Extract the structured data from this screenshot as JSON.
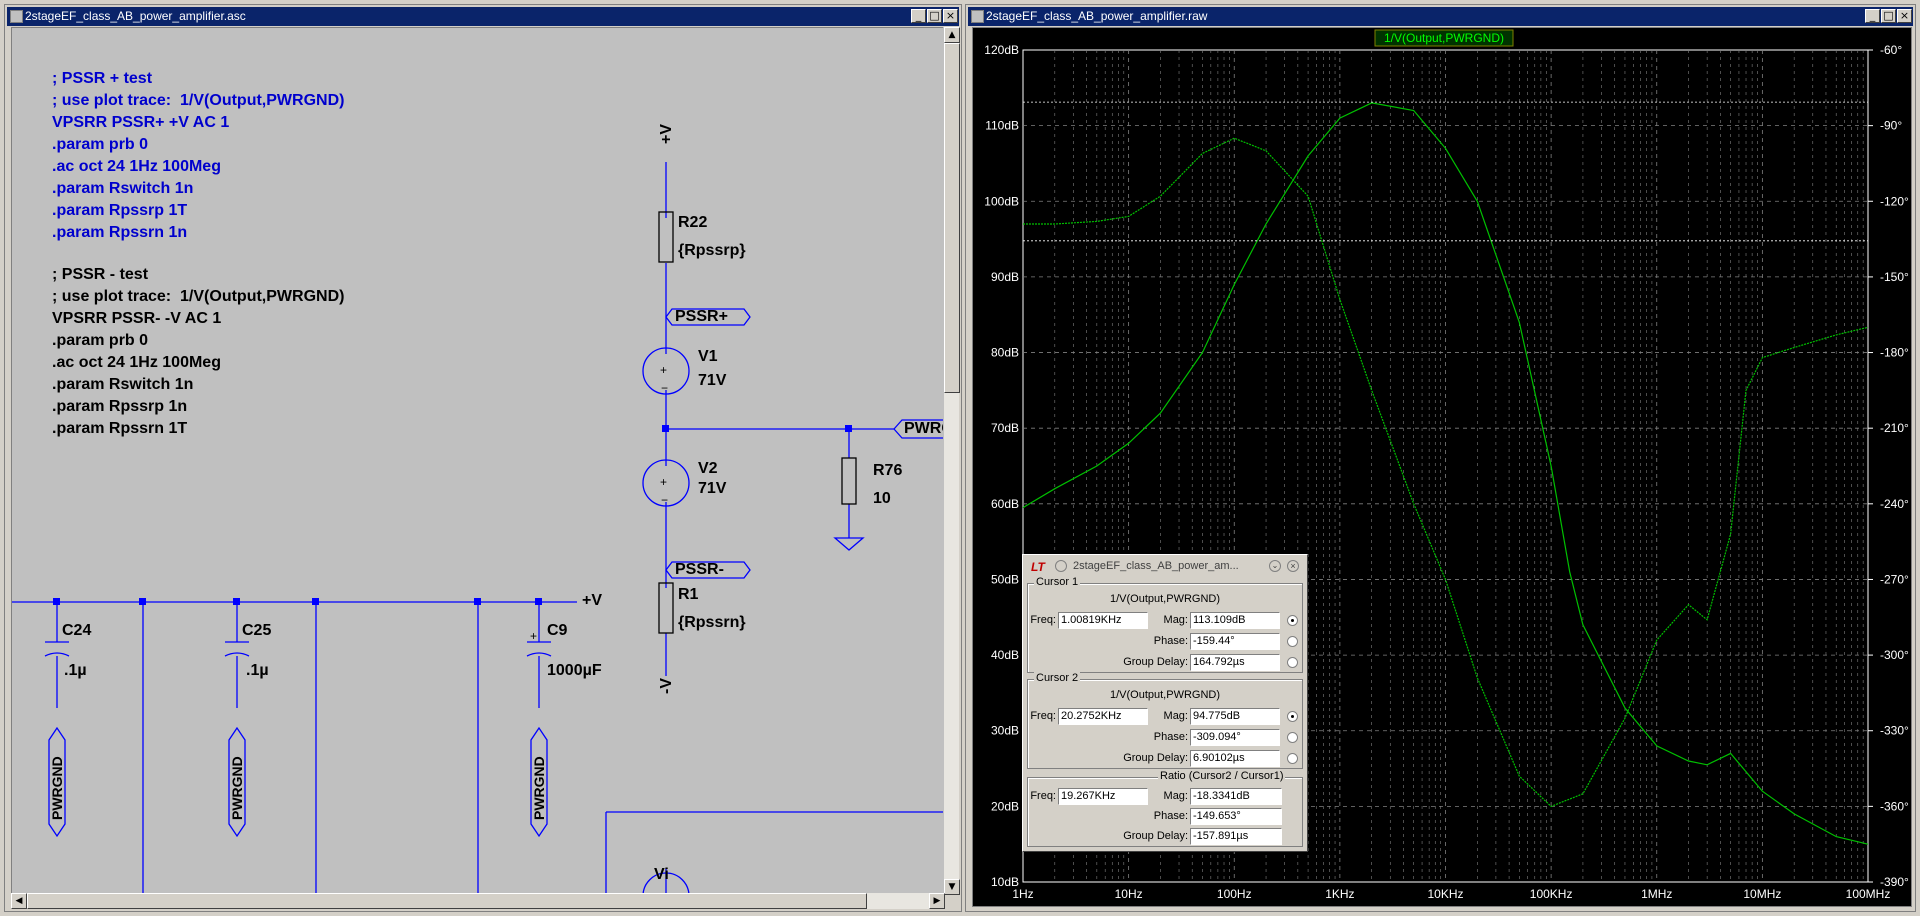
{
  "schematic_window": {
    "title": "2stageEF_class_AB_power_amplifier.asc",
    "directives_pos": [
      "; PSSR + test",
      "; use plot trace:  1/V(Output,PWRGND)",
      "VPSRR PSSR+ +V AC 1",
      ".param prb 0",
      ".ac oct 24 1Hz 100Meg",
      ".param Rswitch 1n",
      ".param Rpssrp 1T",
      ".param Rpssrn 1n"
    ],
    "directives_neg": [
      "; PSSR - test",
      "; use plot trace:  1/V(Output,PWRGND)",
      "VPSRR PSSR- -V AC 1",
      ".param prb 0",
      ".ac oct 24 1Hz 100Meg",
      ".param Rswitch 1n",
      ".param Rpssrp 1n",
      ".param Rpssrn 1T"
    ],
    "components": {
      "r22_name": "R22",
      "r22_value": "{Rpssrp}",
      "v1_name": "V1",
      "v1_value": "71V",
      "v2_name": "V2",
      "v2_value": "71V",
      "r1_name": "R1",
      "r1_value": "{Rpssrn}",
      "r76_name": "R76",
      "r76_value": "10",
      "c24_name": "C24",
      "c24_value": ".1µ",
      "c25_name": "C25",
      "c25_value": ".1µ",
      "c9_name": "C9",
      "c9_value": "1000µF",
      "vi_name": "Vi"
    },
    "net_labels": {
      "plus_v_top": "+V",
      "pssr_plus": "PSSR+",
      "pssr_minus": "PSSR-",
      "minus_v": "-V",
      "pwrgnd_flag": "PWRG",
      "plus_v_rail": "+V",
      "pwrgnd": "PWRGND"
    }
  },
  "plot_window": {
    "title": "2stageEF_class_AB_power_amplifier.raw",
    "trace_label": "1/V(Output,PWRGND)",
    "y_ticks": [
      "120dB",
      "110dB",
      "100dB",
      "90dB",
      "80dB",
      "70dB",
      "60dB",
      "50dB",
      "40dB",
      "30dB",
      "20dB",
      "10dB"
    ],
    "y2_ticks": [
      "-60°",
      "-90°",
      "-120°",
      "-150°",
      "-180°",
      "-210°",
      "-240°",
      "-270°",
      "-300°",
      "-330°",
      "-360°",
      "-390°"
    ],
    "x_ticks": [
      "1Hz",
      "10Hz",
      "100Hz",
      "1KHz",
      "10KHz",
      "100KHz",
      "1MHz",
      "10MHz",
      "100MHz"
    ],
    "colors": {
      "trace": "#00c000",
      "background": "#000000",
      "grid": "#808080",
      "cursor": "#ffffff"
    }
  },
  "chart_data": {
    "type": "line",
    "title": "1/V(Output,PWRGND)",
    "x_scale": "log",
    "xlim": [
      1,
      100000000
    ],
    "ylim": [
      10,
      120
    ],
    "y2lim": [
      -390,
      -60
    ],
    "grid": true,
    "series": [
      {
        "name": "1/V(Output,PWRGND) magnitude",
        "axis": "left",
        "x": [
          1,
          2,
          5,
          10,
          20,
          50,
          100,
          200,
          500,
          1000,
          2000,
          5000,
          10000,
          20000,
          50000,
          100000,
          150000,
          200000,
          500000,
          1000000,
          2000000,
          3000000,
          5000000,
          10000000,
          20000000,
          50000000,
          100000000
        ],
        "y": [
          59.5,
          62,
          65,
          68,
          72,
          80,
          89,
          97,
          106,
          111,
          113,
          112,
          107,
          100,
          84,
          65,
          51,
          44,
          33,
          28,
          26,
          25.5,
          27,
          22,
          19,
          16,
          15
        ]
      },
      {
        "name": "1/V(Output,PWRGND) phase",
        "axis": "right",
        "x": [
          1,
          2,
          5,
          10,
          20,
          50,
          100,
          200,
          500,
          1000,
          2000,
          5000,
          10000,
          20000,
          50000,
          100000,
          200000,
          500000,
          1000000,
          2000000,
          3000000,
          5000000,
          7000000,
          10000000,
          20000000,
          50000000,
          100000000
        ],
        "y": [
          -129,
          -129,
          -128,
          -126,
          -118,
          -101,
          -95,
          -100,
          -118,
          -159,
          -195,
          -240,
          -270,
          -309,
          -348,
          -360,
          -355,
          -325,
          -294,
          -280,
          -286,
          -252,
          -195,
          -182,
          -178,
          -173,
          -170
        ]
      }
    ],
    "cursors": [
      {
        "freq": "1.00819KHz",
        "value": "113.109dB"
      },
      {
        "freq": "20.2752KHz",
        "value": "94.775dB"
      }
    ]
  },
  "cursor_dialog": {
    "title": "2stageEF_class_AB_power_am...",
    "cursor1": {
      "legend": "Cursor 1",
      "trace": "1/V(Output,PWRGND)",
      "freq_label": "Freq:",
      "freq": "1.00819KHz",
      "mag_label": "Mag:",
      "mag": "113.109dB",
      "phase_label": "Phase:",
      "phase": "-159.44°",
      "gd_label": "Group Delay:",
      "gd": "164.792µs"
    },
    "cursor2": {
      "legend": "Cursor 2",
      "trace": "1/V(Output,PWRGND)",
      "freq_label": "Freq:",
      "freq": "20.2752KHz",
      "mag_label": "Mag:",
      "mag": "94.775dB",
      "phase_label": "Phase:",
      "phase": "-309.094°",
      "gd_label": "Group Delay:",
      "gd": "6.90102µs"
    },
    "ratio": {
      "legend": "Ratio (Cursor2 / Cursor1)",
      "freq_label": "Freq:",
      "freq": "19.267KHz",
      "mag_label": "Mag:",
      "mag": "-18.3341dB",
      "phase_label": "Phase:",
      "phase": "-149.653°",
      "gd_label": "Group Delay:",
      "gd": "-157.891µs"
    }
  }
}
